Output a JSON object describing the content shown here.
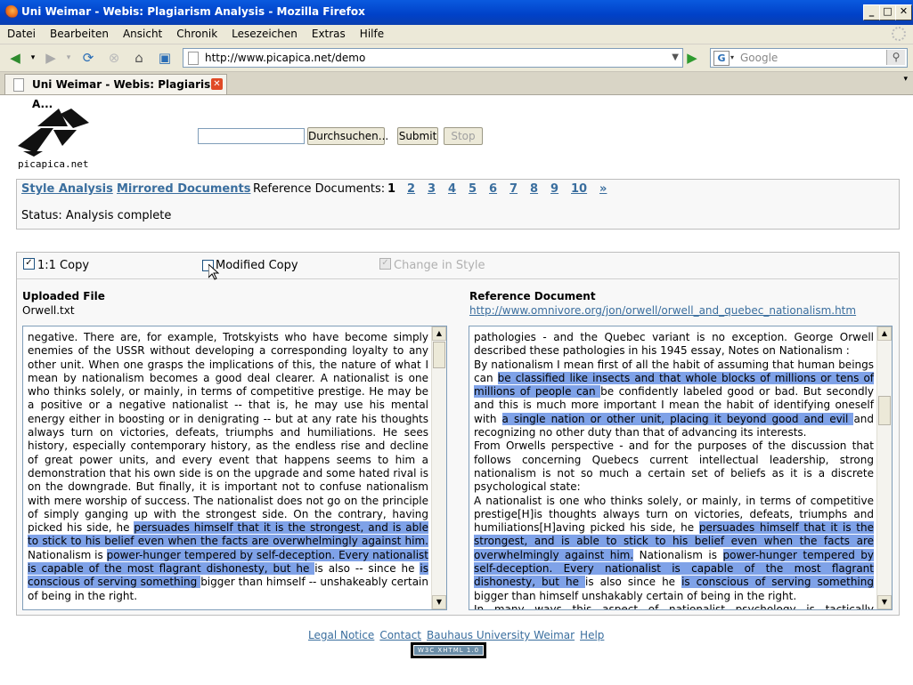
{
  "window": {
    "title": "Uni Weimar - Webis: Plagiarism Analysis - Mozilla Firefox"
  },
  "menu": [
    "Datei",
    "Bearbeiten",
    "Ansicht",
    "Chronik",
    "Lesezeichen",
    "Extras",
    "Hilfe"
  ],
  "nav": {
    "url": "http://www.picapica.net/demo",
    "search_placeholder": "Google"
  },
  "tab": {
    "label": "Uni Weimar - Webis: Plagiarism A..."
  },
  "logo": {
    "text": "picapica.net"
  },
  "upload": {
    "browse_label": "Durchsuchen...",
    "submit_label": "Submit",
    "stop_label": "Stop"
  },
  "links": {
    "style": "Style Analysis",
    "mirrored": "Mirrored Documents",
    "ref_label": "Reference Documents:",
    "pages": [
      "1",
      "2",
      "3",
      "4",
      "5",
      "6",
      "7",
      "8",
      "9",
      "10",
      "»"
    ]
  },
  "status": "Status: Analysis complete",
  "options": {
    "one_to_one": "1:1 Copy",
    "modified": "Modified Copy",
    "change_style": "Change in Style"
  },
  "left": {
    "heading": "Uploaded File",
    "filename": "Orwell.txt"
  },
  "right": {
    "heading": "Reference Document",
    "link": "http://www.omnivore.org/jon/orwell/orwell_and_quebec_nationalism.htm"
  },
  "footer": {
    "legal": "Legal Notice",
    "contact": "Contact",
    "bauhaus": "Bauhaus University Weimar",
    "help": "Help",
    "badge": "W3C XHTML 1.0"
  },
  "left_text": {
    "p1": "negative. There are, for example, Trotskyists who have become simply enemies of the USSR without developing a corresponding loyalty to any other unit. When one grasps the implications of this, the nature of what I mean by nationalism becomes a good deal clearer. A nationalist is one who thinks solely, or mainly, in terms of competitive prestige. He may be a positive or a negative nationalist -- that is, he may use his mental energy either in boosting or in denigrating -- but at any rate his thoughts always turn on victories, defeats, triumphs and humiliations. He sees history, especially contemporary history, as the endless rise and decline of great power units, and every event that happens seems to him a demonstration that his own side is on the upgrade and some hated rival is on the downgrade. But finally, it is important not to confuse nationalism with mere worship of success. The nationalist does not go on the principle of simply ganging up with the strongest side. On the contrary, having picked his side, he ",
    "h1": "persuades himself that it is the strongest, and is able to stick to his belief even when the facts are overwhelmingly against him.",
    "t2": " Nationalism is ",
    "h2": "power-hunger tempered by self-deception. Every nationalist is capable of the most flagrant dishonesty, but he ",
    "t3": "is also -- since he ",
    "h3": "is conscious of serving something ",
    "t4": "bigger than himself -- unshakeably certain of being in the right."
  },
  "right_text": {
    "p1": "pathologies - and the Quebec variant is no exception. George Orwell described these pathologies in his 1945 essay, Notes on Nationalism :",
    "p2a": "By nationalism I mean first of all the habit of assuming that human beings can ",
    "p2h1": "be classified like insects and that whole blocks of millions or tens of millions of people can ",
    "p2b": "be confidently labeled good or bad. But secondly and this is much more important I mean the habit of identifying oneself with ",
    "p2h2": "a single nation or other unit, placing it beyond good and evil ",
    "p2c": "and recognizing no other duty than that of advancing its interests.",
    "p3": "From Orwells perspective - and for the purposes of the discussion that follows concerning Quebecs current intellectual leadership, strong nationalism is not so much a certain set of beliefs as it is a discrete psychological state:",
    "p4a": "A nationalist is one who thinks solely, or mainly, in terms of competitive prestige[H]is thoughts always turn on victories, defeats, triumphs and humiliations[H]aving picked his side, he ",
    "p4h1": "persuades himself that it is the strongest, and is able to stick to his belief even when the facts are overwhelmingly against him.",
    "p4b": " Nationalism is ",
    "p4h2": "power-hunger tempered by self-deception. Every nationalist is capable of the most flagrant dishonesty, but he ",
    "p4c": "is also since he ",
    "p4h3": "is conscious of serving something ",
    "p4d": "bigger than himself unshakably certain of being in the right.",
    "p5": "In many ways this aspect of nationalist psychology is tactically advantageous. It permits the devout to unconsciously pervert the normal rules of logic by"
  }
}
